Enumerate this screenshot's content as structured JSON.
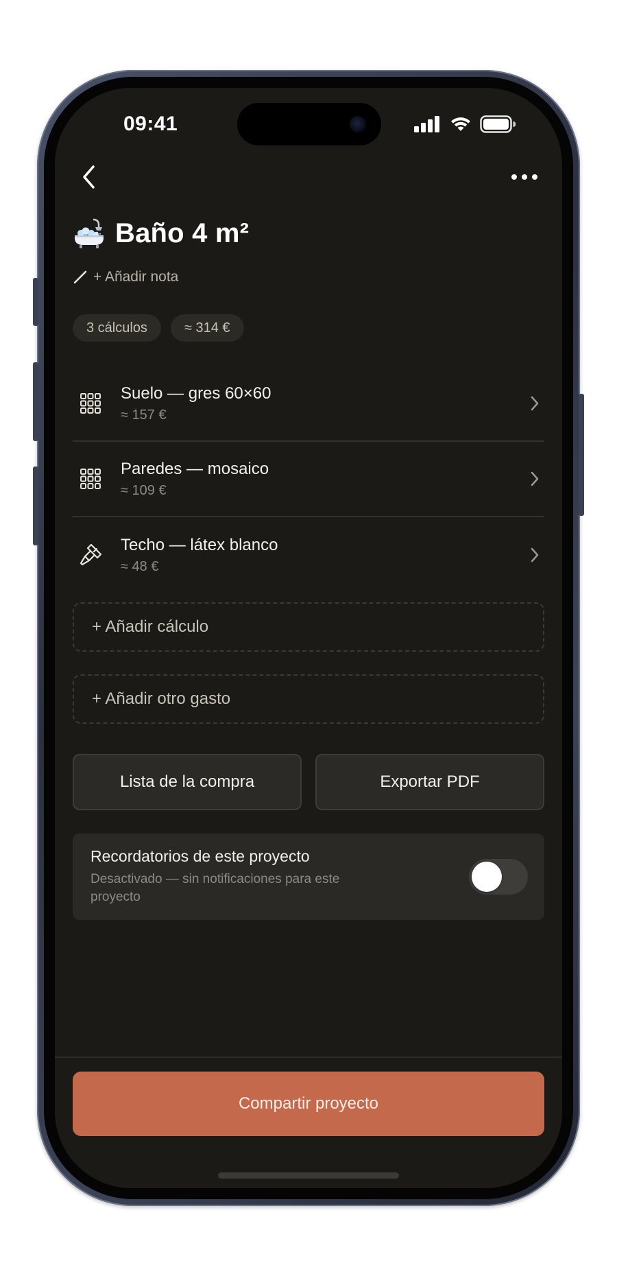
{
  "status_bar": {
    "time": "09:41",
    "icons": [
      "cellular-signal-icon",
      "wifi-icon",
      "battery-icon"
    ]
  },
  "nav": {
    "back_icon": "chevron-left-icon",
    "more_icon": "ellipsis-icon"
  },
  "project": {
    "emoji_icon": "bathtub-icon",
    "title": "Baño 4 m²",
    "add_note_label": "+ Añadir nota",
    "chips": [
      "3 cálculos",
      "≈ 314 €"
    ]
  },
  "calculations": [
    {
      "icon": "tile-grid-icon",
      "title": "Suelo — gres 60×60",
      "price": "≈ 157 €"
    },
    {
      "icon": "tile-grid-icon",
      "title": "Paredes — mosaico",
      "price": "≈ 109 €"
    },
    {
      "icon": "paint-brush-icon",
      "title": "Techo — látex blanco",
      "price": "≈ 48 €"
    }
  ],
  "add_calculation_label": "+ Añadir cálculo",
  "add_expense_label": "+ Añadir otro gasto",
  "actions": {
    "shopping_list_label": "Lista de la compra",
    "export_pdf_label": "Exportar PDF"
  },
  "reminders": {
    "title": "Recordatorios de este proyecto",
    "subtitle": "Desactivado — sin notificaciones para este proyecto",
    "enabled": false
  },
  "share_label": "Compartir proyecto",
  "colors": {
    "background": "#1b1a17",
    "accent": "#c4694b",
    "card": "#2a2925",
    "muted_text": "#8e8a82"
  }
}
